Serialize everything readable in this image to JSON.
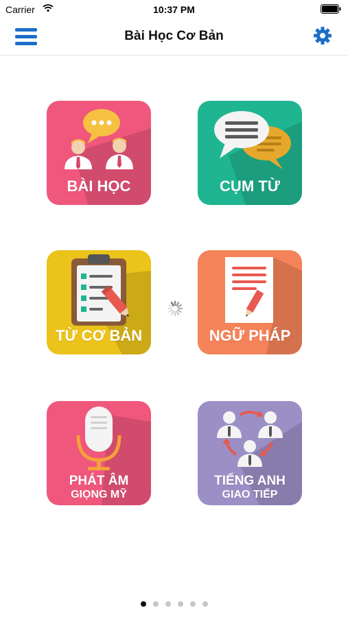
{
  "status_bar": {
    "carrier": "Carrier",
    "time": "10:37 PM"
  },
  "nav": {
    "title": "Bài Học Cơ Bản",
    "menu_icon": "hamburger-menu-icon",
    "settings_icon": "gear-icon",
    "accent_color": "#1b6fc8"
  },
  "tiles": [
    {
      "label": "BÀI HỌC",
      "icon": "people-chat-icon",
      "color": "#f0577c"
    },
    {
      "label": "CỤM TỪ",
      "icon": "speech-bubbles-icon",
      "color": "#20b591"
    },
    {
      "label": "TỪ CƠ BẢN",
      "icon": "clipboard-checklist-icon",
      "color": "#ebc31a"
    },
    {
      "label": "NGỮ PHÁP",
      "icon": "document-pencil-icon",
      "color": "#f4835a"
    },
    {
      "label": "PHÁT ÂM",
      "sublabel": "GIỌNG MỸ",
      "icon": "microphone-icon",
      "color": "#f0577c"
    },
    {
      "label": "TIẾNG ANH",
      "sublabel": "GIAO TIẾP",
      "icon": "people-network-icon",
      "color": "#9b8fc6"
    }
  ],
  "pager": {
    "count": 6,
    "active_index": 0
  }
}
